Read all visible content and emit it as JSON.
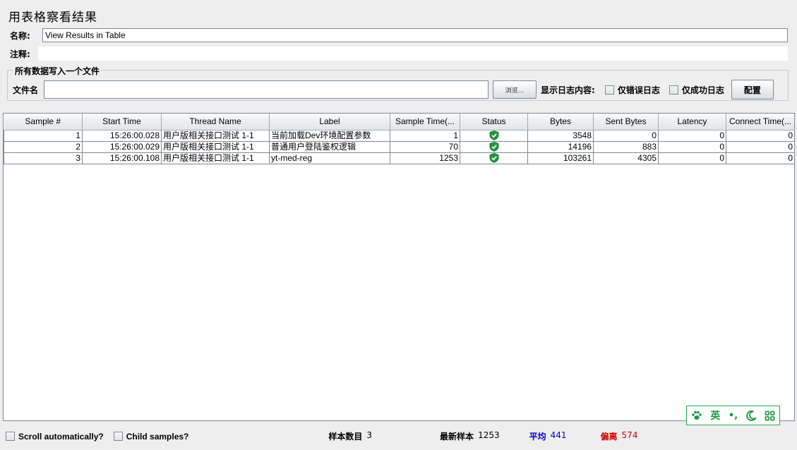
{
  "panel": {
    "title": "用表格察看结果"
  },
  "form": {
    "name_label": "名称:",
    "name_value": "View Results in Table",
    "comment_label": "注释:",
    "comment_value": ""
  },
  "file_group": {
    "title": "所有数据写入一个文件",
    "filename_label": "文件名",
    "filename_value": "",
    "browse_label": "浏览...",
    "log_content_label": "显示日志内容:",
    "errors_only_label": "仅错误日志",
    "success_only_label": "仅成功日志",
    "configure_label": "配置"
  },
  "table": {
    "columns": [
      "Sample #",
      "Start Time",
      "Thread Name",
      "Label",
      "Sample Time(...",
      "Status",
      "Bytes",
      "Sent Bytes",
      "Latency",
      "Connect Time(..."
    ],
    "rows": [
      {
        "sample": "1",
        "start": "15:26:00.028",
        "thread": "用户版相关接口测试 1-1",
        "label": "当前加载Dev环境配置参数",
        "time": "1",
        "status": "success",
        "bytes": "3548",
        "sent": "0",
        "latency": "0",
        "connect": "0"
      },
      {
        "sample": "2",
        "start": "15:26:00.029",
        "thread": "用户版相关接口测试 1-1",
        "label": "普通用户登陆鉴权逻辑",
        "time": "70",
        "status": "success",
        "bytes": "14196",
        "sent": "883",
        "latency": "0",
        "connect": "0"
      },
      {
        "sample": "3",
        "start": "15:26:00.108",
        "thread": "用户版相关接口测试 1-1",
        "label": "yt-med-reg",
        "time": "1253",
        "status": "success",
        "bytes": "103261",
        "sent": "4305",
        "latency": "0",
        "connect": "0"
      }
    ]
  },
  "footer": {
    "scroll_label": "Scroll automatically?",
    "child_label": "Child samples?",
    "sample_count_label": "样本数目",
    "sample_count_value": "3",
    "latest_label": "最新样本",
    "latest_value": "1253",
    "average_label": "平均",
    "average_value": "441",
    "deviation_label": "偏离",
    "deviation_value": "574"
  },
  "ime": {
    "lang": "英",
    "punct": "•,",
    "icons": [
      "paw-icon",
      "moon-icon",
      "grid-icon"
    ]
  },
  "colors": {
    "average": "#0000cc",
    "deviation": "#cc0000",
    "success": "#1e9a3a",
    "ime": "#1c9a3e"
  }
}
